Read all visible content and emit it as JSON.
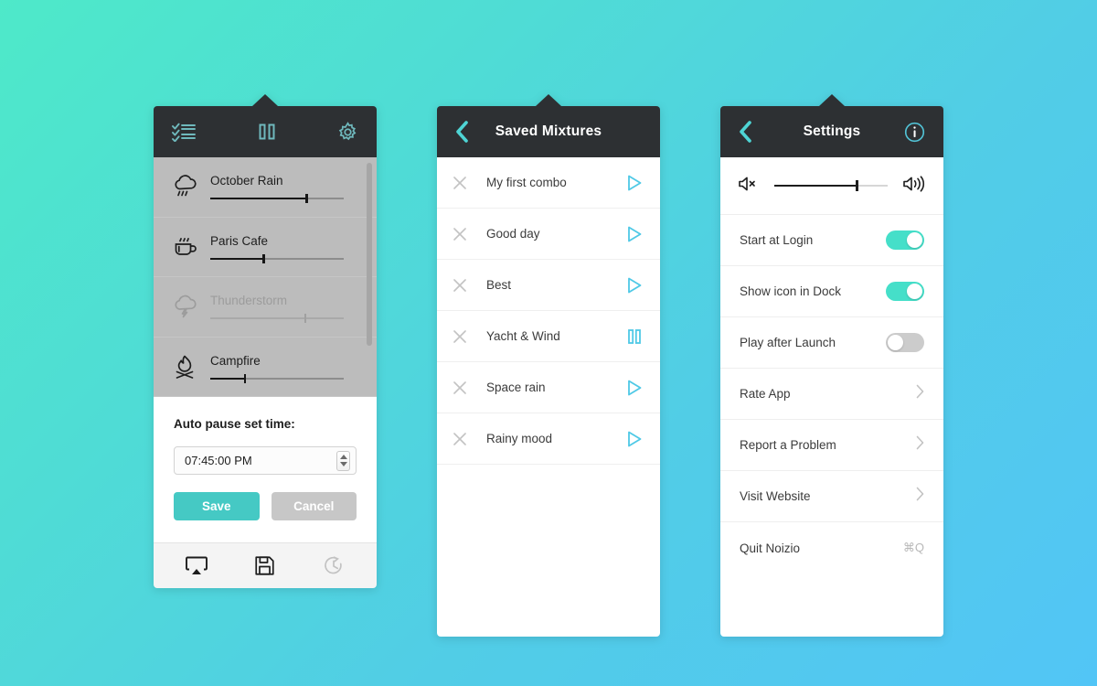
{
  "theme": {
    "bg_gradient_start": "#4EE9C9",
    "bg_gradient_end": "#52C5F6",
    "header_bg": "#2D3033",
    "accent_teal": "#45C9C4",
    "toggle_on": "#45DFC9",
    "toggle_off": "#CCCCCC",
    "play_icon_color": "#4FC9E6"
  },
  "panel_sounds": {
    "toolbar": {
      "mixtures_icon": "checklist-icon",
      "playpause_icon": "pause-icon",
      "settings_icon": "gear-icon"
    },
    "sounds": [
      {
        "name": "October Rain",
        "icon": "rain-cloud-icon",
        "volume": 72,
        "active": true
      },
      {
        "name": "Paris Cafe",
        "icon": "coffee-cup-icon",
        "volume": 40,
        "active": true
      },
      {
        "name": "Thunderstorm",
        "icon": "thunder-cloud-icon",
        "volume": 71,
        "active": false
      },
      {
        "name": "Campfire",
        "icon": "campfire-icon",
        "volume": 26,
        "active": true
      }
    ],
    "auto_pause": {
      "title": "Auto pause set time:",
      "time_value": "07:45:00 PM",
      "save_label": "Save",
      "cancel_label": "Cancel"
    },
    "footer": {
      "airplay_icon": "airplay-icon",
      "save_icon": "floppy-save-icon",
      "timer_icon": "timer-icon"
    }
  },
  "panel_mixtures": {
    "back_icon": "chevron-left-icon",
    "title": "Saved Mixtures",
    "items": [
      {
        "name": "My first combo",
        "state": "play"
      },
      {
        "name": "Good day",
        "state": "play"
      },
      {
        "name": "Best",
        "state": "play"
      },
      {
        "name": "Yacht & Wind",
        "state": "pause"
      },
      {
        "name": "Space rain",
        "state": "play"
      },
      {
        "name": "Rainy mood",
        "state": "play"
      }
    ]
  },
  "panel_settings": {
    "back_icon": "chevron-left-icon",
    "title": "Settings",
    "info_icon": "info-circle-icon",
    "volume": {
      "mute_icon": "volume-mute-icon",
      "max_icon": "volume-high-icon",
      "level": 72
    },
    "toggles": [
      {
        "label": "Start at Login",
        "on": true
      },
      {
        "label": "Show icon in Dock",
        "on": true
      },
      {
        "label": "Play after Launch",
        "on": false
      }
    ],
    "links": [
      {
        "label": "Rate App",
        "shortcut": "",
        "chevron": true
      },
      {
        "label": "Report a Problem",
        "shortcut": "",
        "chevron": true
      },
      {
        "label": "Visit Website",
        "shortcut": "",
        "chevron": true
      },
      {
        "label": "Quit Noizio",
        "shortcut": "⌘Q",
        "chevron": false
      }
    ]
  }
}
